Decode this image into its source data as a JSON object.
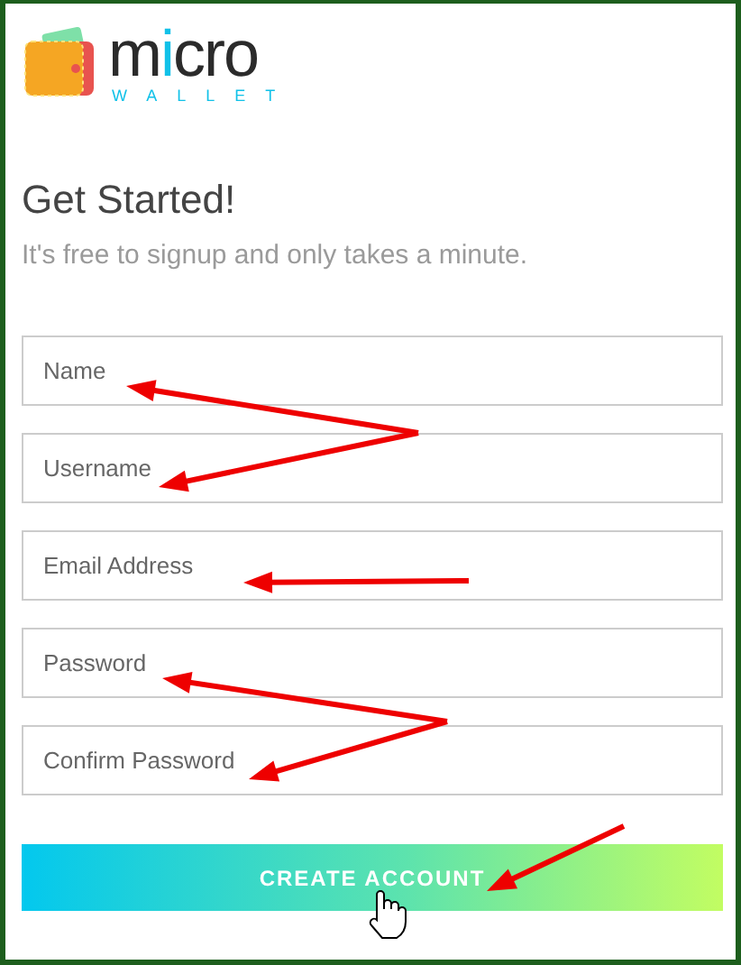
{
  "logo": {
    "word": "micro",
    "tagline": "WALLET"
  },
  "heading": "Get Started!",
  "subtitle": "It's free to signup and only takes a minute.",
  "fields": [
    {
      "placeholder": "Name"
    },
    {
      "placeholder": "Username"
    },
    {
      "placeholder": "Email Address"
    },
    {
      "placeholder": "Password"
    },
    {
      "placeholder": "Confirm Password"
    }
  ],
  "submit_button": "CREATE ACCOUNT"
}
